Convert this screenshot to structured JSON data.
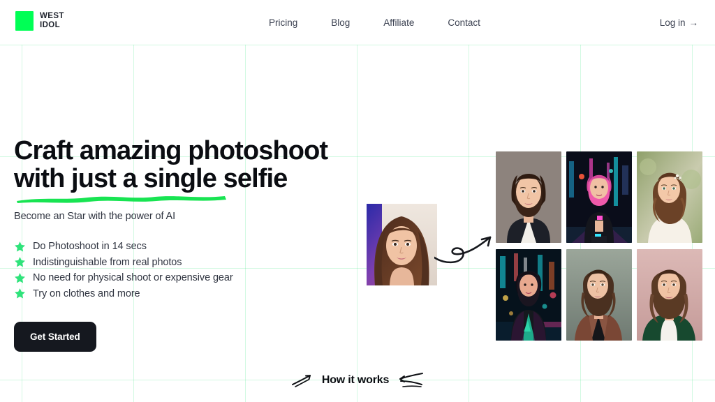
{
  "brand": {
    "line1": "WEST",
    "line2": "IDOL",
    "mark_color": "#00ff55",
    "mark_icon": "green-square-logo-mark"
  },
  "nav": {
    "items": [
      {
        "label": "Pricing",
        "name": "nav-item-pricing"
      },
      {
        "label": "Blog",
        "name": "nav-item-blog"
      },
      {
        "label": "Affiliate",
        "name": "nav-item-affiliate"
      },
      {
        "label": "Contact",
        "name": "nav-item-contact"
      }
    ],
    "login_label": "Log in",
    "login_arrow": "→"
  },
  "hero": {
    "headline_line1": "Craft amazing photoshoot",
    "headline_line2": "with just a single selfie",
    "underline_color": "#18e452",
    "subtitle": "Become an Star with the power of AI",
    "features": [
      {
        "text": "Do Photoshoot in 14 secs",
        "icon": "star-icon"
      },
      {
        "text": "Indistinguishable from real photos",
        "icon": "star-icon"
      },
      {
        "text": "No need for physical shoot or expensive gear",
        "icon": "star-icon"
      },
      {
        "text": "Try on clothes and more",
        "icon": "star-icon"
      }
    ],
    "cta_label": "Get Started",
    "cta_bg": "#15181f",
    "star_color": "#2fe37b"
  },
  "showcase": {
    "source_photo_alt": "input-selfie-portrait",
    "arrow_alt": "curved-transform-arrow",
    "photos": [
      {
        "alt": "ai-portrait-business-suit"
      },
      {
        "alt": "ai-portrait-cyberpunk-neon-pink-hair"
      },
      {
        "alt": "ai-portrait-bridal-white-dress"
      },
      {
        "alt": "ai-portrait-neon-street-leather-jacket"
      },
      {
        "alt": "ai-portrait-brown-blazer-studio"
      },
      {
        "alt": "ai-portrait-green-sweater-pink-backdrop"
      }
    ]
  },
  "how_it_works": {
    "label": "How it works",
    "deco_left": "hand-drawn-arrow-left",
    "deco_right": "hand-drawn-arrow-right"
  }
}
